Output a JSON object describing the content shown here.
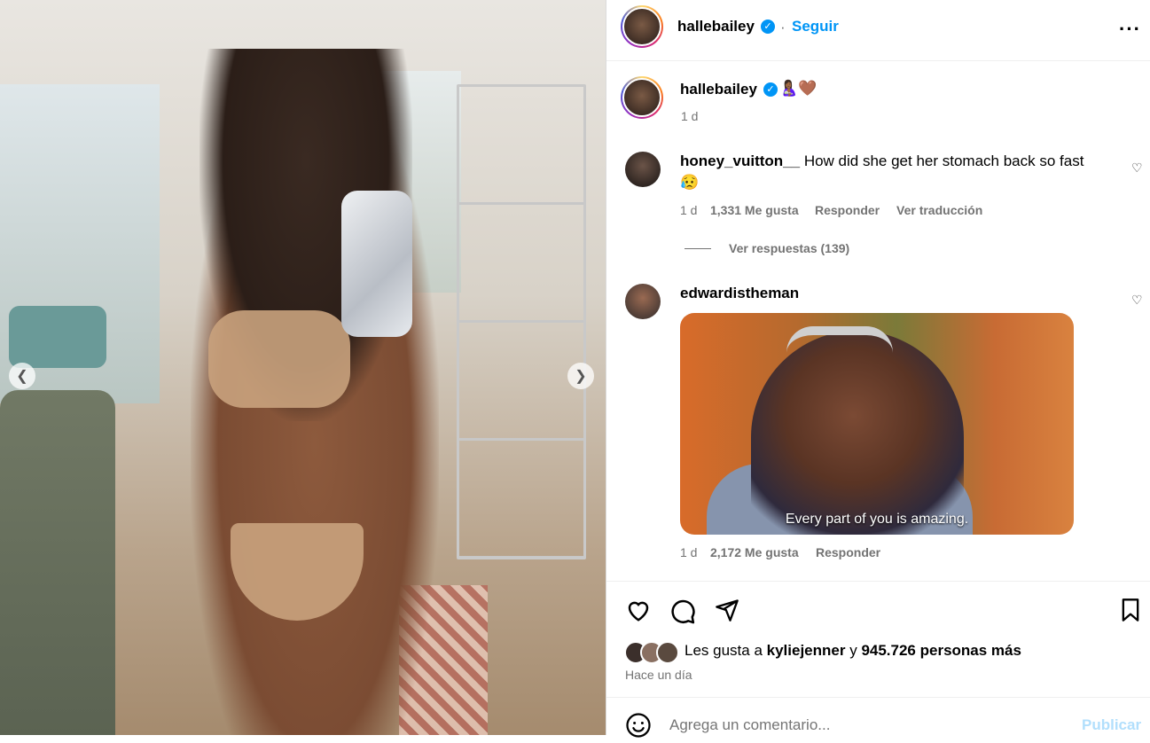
{
  "header": {
    "username": "hallebailey",
    "separator": "·",
    "follow_label": "Seguir",
    "more_icon": "more-horizontal-icon"
  },
  "caption": {
    "username": "hallebailey",
    "emojis": "🤱🏾🤎",
    "time": "1 d"
  },
  "comments": [
    {
      "username": "honey_vuitton__",
      "text": "How did she get her stomach back so fast",
      "emoji": "😥",
      "time": "1 d",
      "likes": "1,331 Me gusta",
      "reply_label": "Responder",
      "translate_label": "Ver traducción",
      "view_replies_label": "Ver respuestas (139)"
    },
    {
      "username": "edwardistheman",
      "gif_caption": "Every part of you is amazing.",
      "time": "1 d",
      "likes": "2,172 Me gusta",
      "reply_label": "Responder"
    }
  ],
  "actions": {
    "like_icon": "heart-icon",
    "comment_icon": "comment-icon",
    "share_icon": "send-icon",
    "save_icon": "bookmark-icon"
  },
  "likes_summary": {
    "prefix": "Les gusta a",
    "user": "kyliejenner",
    "connector": "y",
    "others": "945.726 personas más"
  },
  "post_time": "Hace un día",
  "comment_box": {
    "emoji_icon": "smiley-icon",
    "placeholder": "Agrega un comentario...",
    "publish_label": "Publicar"
  },
  "colors": {
    "link_blue": "#0095f6",
    "muted": "#737373",
    "publish_disabled": "#b2dffc"
  }
}
